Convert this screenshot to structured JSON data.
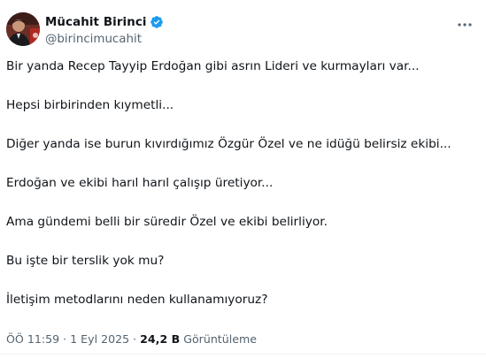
{
  "author": {
    "display_name": "Mücahit Birinci",
    "handle": "@birincimucahit",
    "verified": true,
    "verified_color": "#1d9bf0"
  },
  "icons": {
    "verified": "verified-badge-icon",
    "more": "more-horizontal-icon"
  },
  "tweet": {
    "paragraphs": [
      "Bir yanda Recep Tayyip Erdoğan gibi asrın Lideri ve kurmayları var...",
      "Hepsi birbirinden kıymetli...",
      "Diğer yanda ise burun kıvırdığımız Özgür Özel ve ne idüğü belirsiz ekibi...",
      "Erdoğan ve ekibi harıl harıl çalışıp üretiyor...",
      "Ama gündemi belli bir süredir Özel ve ekibi belirliyor.",
      "Bu işte bir terslik yok mu?",
      "İletişim metodlarını neden kullanamıyoruz?"
    ]
  },
  "meta": {
    "time": "ÖÖ 11:59",
    "separator": "·",
    "date": "1 Eyl 2025",
    "views_count": "24,2 B",
    "views_label": "Görüntüleme"
  },
  "colors": {
    "text_primary": "#0f1419",
    "text_secondary": "#536471",
    "accent": "#1d9bf0"
  }
}
